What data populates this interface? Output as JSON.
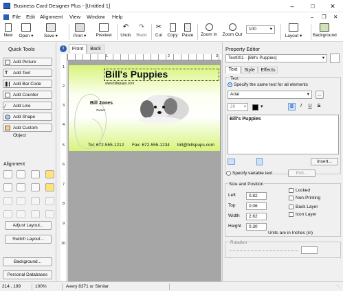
{
  "app": {
    "title": "Business Card Designer Plus - [Untitled 1]"
  },
  "menu": [
    "File",
    "Edit",
    "Alignment",
    "View",
    "Window",
    "Help"
  ],
  "toolbar": {
    "new": "New",
    "open": "Open",
    "save": "Save",
    "print": "Print",
    "preview": "Preview",
    "undo": "Undo",
    "redo": "Redo",
    "cut": "Cut",
    "copy": "Copy",
    "paste": "Paste",
    "zoom_in": "Zoom In",
    "zoom_out": "Zoom Out",
    "zoom_value": "100",
    "layout": "Layout",
    "background": "Background"
  },
  "quick_tools": {
    "title": "Quick Tools",
    "buttons": [
      "Add Picture",
      "Add Text",
      "Add Bar Code",
      "Add Counter",
      "Add Line",
      "Add Shape",
      "Add Custom Object"
    ]
  },
  "alignment": {
    "title": "Alignment",
    "adjust_layout": "Adjust Layout...",
    "switch_layout": "Switch Layout...",
    "background": "Background...",
    "personal_db": "Personal Databases"
  },
  "tabs": {
    "front": "Front",
    "back": "Back"
  },
  "ruler_h": [
    "1",
    "2",
    "3"
  ],
  "ruler_v": [
    "1",
    "2",
    "3",
    "4",
    "5",
    "6",
    "7",
    "8",
    "9",
    "10"
  ],
  "card": {
    "name": "Bill's Puppies",
    "website": "www.billspups.com",
    "person": "Bill Jones",
    "role": "Owner",
    "tel": "Tel: 672-555-1212",
    "fax": "Fax: 672-555-1234",
    "email": "bill@billspups.com",
    "bg_color": "#d7f47a"
  },
  "property_editor": {
    "title": "Property Editor",
    "object": "Text001 - [Bill's Puppies]",
    "tabs": [
      "Text",
      "Style",
      "Effects"
    ],
    "text_group": "Text",
    "specify_same": "Specify the same text for all elements",
    "font": "Arial",
    "size": "20",
    "bold": "B",
    "italic": "I",
    "underline": "U",
    "strike": "S",
    "text_value": "Bill's Puppies",
    "insert": "Insert...",
    "specify_variable": "Specify variable text",
    "edit": "Edit...",
    "size_pos": "Size and Position",
    "left_label": "Left",
    "left": "0.82",
    "top_label": "Top",
    "top": "0.06",
    "width_label": "Width",
    "width": "2.62",
    "height_label": "Height",
    "height": "0.30",
    "locked": "Locked",
    "non_printing": "Non-Printing",
    "back_layer": "Back Layer",
    "icon_layer": "Icon Layer",
    "units": "Units are in Inches (in)",
    "rotation": "Rotation"
  },
  "status": {
    "coords": "214 , 199",
    "zoom": "100%",
    "paper": "Avery 8371 or Similar"
  }
}
